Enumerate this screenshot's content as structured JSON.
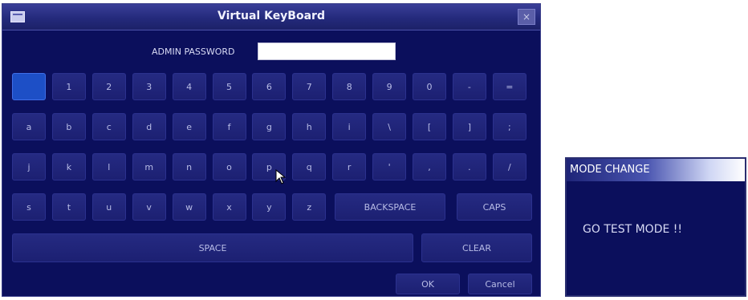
{
  "keyboard_window": {
    "title": "Virtual KeyBoard",
    "close_label": "×",
    "password_label": "ADMIN PASSWORD",
    "password_value": "",
    "rows": [
      [
        "",
        "1",
        "2",
        "3",
        "4",
        "5",
        "6",
        "7",
        "8",
        "9",
        "0",
        "-",
        "="
      ],
      [
        "a",
        "b",
        "c",
        "d",
        "e",
        "f",
        "g",
        "h",
        "i",
        "\\",
        "[",
        "]",
        ";"
      ],
      [
        "j",
        "k",
        "l",
        "m",
        "n",
        "o",
        "p",
        "q",
        "r",
        "'",
        ",",
        ".",
        "/"
      ],
      [
        "s",
        "t",
        "u",
        "v",
        "w",
        "x",
        "y",
        "z"
      ]
    ],
    "backspace_label": "BACKSPACE",
    "caps_label": "CAPS",
    "space_label": "SPACE",
    "clear_label": "CLEAR",
    "ok_label": "OK",
    "cancel_label": "Cancel",
    "selected_key": "row-0-key-0"
  },
  "mode_dialog": {
    "title": "MODE CHANGE",
    "message": "GO TEST MODE !!"
  },
  "colors": {
    "window_bg": "#0b0f5c",
    "key_bg": "#1f247a",
    "selected_key": "#1d4fc6",
    "text": "#b8bce6"
  },
  "icons": [
    "window-icon",
    "close-icon",
    "mouse-cursor-icon"
  ]
}
